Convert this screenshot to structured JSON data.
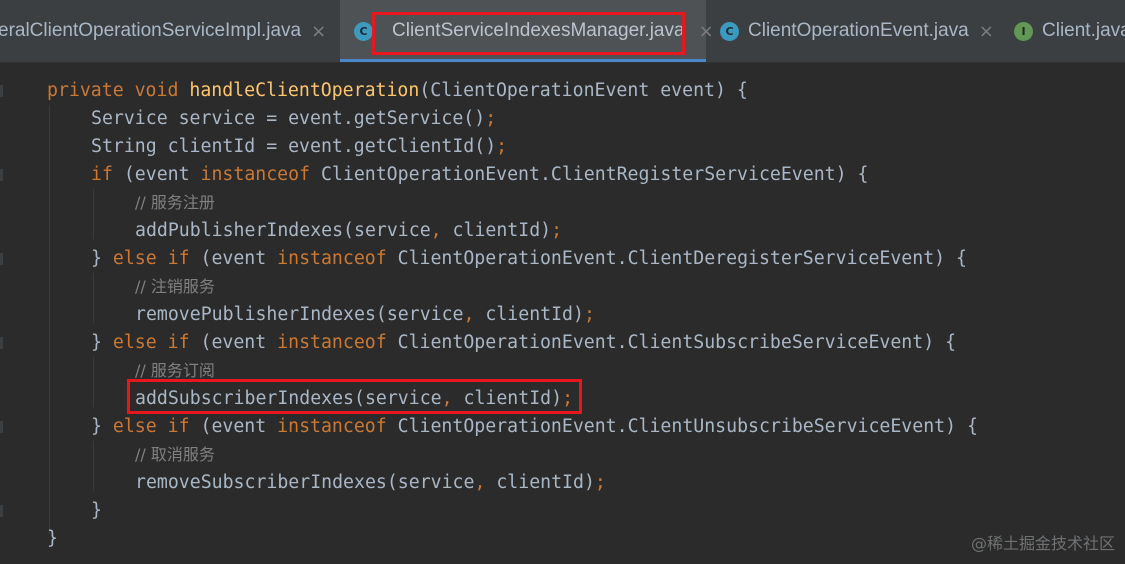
{
  "tabs": [
    {
      "label": "eralClientOperationServiceImpl.java",
      "icon": "none",
      "active": false
    },
    {
      "label": "ClientServiceIndexesManager.java",
      "icon": "class-icon",
      "active": true
    },
    {
      "label": "ClientOperationEvent.java",
      "icon": "class-icon",
      "active": false
    },
    {
      "label": "Client.java",
      "icon": "interface-icon",
      "active": false
    }
  ],
  "tab_close_glyph": "×",
  "icon_letters": {
    "class": "C",
    "interface": "I"
  },
  "code": {
    "l1": {
      "kw1": "private",
      "kw2": "void",
      "fn": "handleClientOperation",
      "rest": "(ClientOperationEvent event) {"
    },
    "l2": {
      "a": "Service service = event.getService()",
      "semi": ";"
    },
    "l3": {
      "a": "String clientId = event.getClientId()",
      "semi": ";"
    },
    "l4": {
      "kw": "if",
      "a": " (event ",
      "kw2": "instanceof",
      "b": " ClientOperationEvent.ClientRegisterServiceEvent) {"
    },
    "l5": {
      "comment": "// 服务注册"
    },
    "l6": {
      "a": "addPublisherIndexes(service",
      "comma": ",",
      "b": " clientId)",
      "semi": ";"
    },
    "l7": {
      "a": "} ",
      "kw": "else if",
      "b": " (event ",
      "kw2": "instanceof",
      "c": " ClientOperationEvent.ClientDeregisterServiceEvent) {"
    },
    "l8": {
      "comment": "// 注销服务"
    },
    "l9": {
      "a": "removePublisherIndexes(service",
      "comma": ",",
      "b": " clientId)",
      "semi": ";"
    },
    "l10": {
      "a": "} ",
      "kw": "else if",
      "b": " (event ",
      "kw2": "instanceof",
      "c": " ClientOperationEvent.ClientSubscribeServiceEvent) {"
    },
    "l11": {
      "comment": "// 服务订阅"
    },
    "l12": {
      "a": "addSubscriberIndexes(service",
      "comma": ",",
      "b": " clientId)",
      "semi": ";"
    },
    "l13": {
      "a": "} ",
      "kw": "else if",
      "b": " (event ",
      "kw2": "instanceof",
      "c": " ClientOperationEvent.ClientUnsubscribeServiceEvent) {"
    },
    "l14": {
      "comment": "// 取消服务"
    },
    "l15": {
      "a": "removeSubscriberIndexes(service",
      "comma": ",",
      "b": " clientId)",
      "semi": ";"
    },
    "l16": {
      "a": "}"
    },
    "l17": {
      "a": "}"
    }
  },
  "watermark": "@稀土掘金技术社区",
  "colors": {
    "background": "#2b2b2b",
    "keyword": "#cc7832",
    "method_decl": "#ffc66d",
    "comment": "#808080",
    "text": "#a9b7c6",
    "highlight_box": "#e6171d"
  }
}
